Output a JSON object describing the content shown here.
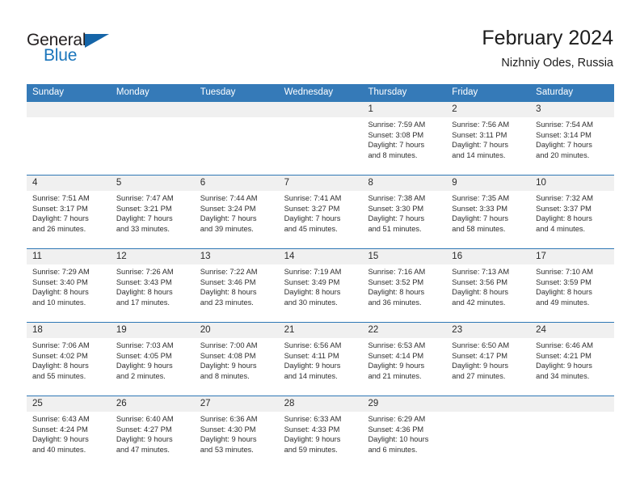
{
  "brand": {
    "name_primary": "General",
    "name_secondary": "Blue",
    "triangle_icon": "triangle-icon",
    "accent_color": "#1a75bb"
  },
  "header": {
    "title": "February 2024",
    "location": "Nizhniy Odes, Russia"
  },
  "colors": {
    "header_blue": "#357ab8",
    "row_separator_blue": "#2f78b5",
    "date_band_gray": "#f0f0f0",
    "logo_blue": "#1a75bb"
  },
  "calendar": {
    "weekday_headers": [
      "Sunday",
      "Monday",
      "Tuesday",
      "Wednesday",
      "Thursday",
      "Friday",
      "Saturday"
    ],
    "weeks": [
      {
        "days": [
          {
            "date": "",
            "sunrise": "",
            "sunset": "",
            "daylight_line1": "",
            "daylight_line2": ""
          },
          {
            "date": "",
            "sunrise": "",
            "sunset": "",
            "daylight_line1": "",
            "daylight_line2": ""
          },
          {
            "date": "",
            "sunrise": "",
            "sunset": "",
            "daylight_line1": "",
            "daylight_line2": ""
          },
          {
            "date": "",
            "sunrise": "",
            "sunset": "",
            "daylight_line1": "",
            "daylight_line2": ""
          },
          {
            "date": "1",
            "sunrise": "Sunrise: 7:59 AM",
            "sunset": "Sunset: 3:08 PM",
            "daylight_line1": "Daylight: 7 hours",
            "daylight_line2": "and 8 minutes."
          },
          {
            "date": "2",
            "sunrise": "Sunrise: 7:56 AM",
            "sunset": "Sunset: 3:11 PM",
            "daylight_line1": "Daylight: 7 hours",
            "daylight_line2": "and 14 minutes."
          },
          {
            "date": "3",
            "sunrise": "Sunrise: 7:54 AM",
            "sunset": "Sunset: 3:14 PM",
            "daylight_line1": "Daylight: 7 hours",
            "daylight_line2": "and 20 minutes."
          }
        ]
      },
      {
        "days": [
          {
            "date": "4",
            "sunrise": "Sunrise: 7:51 AM",
            "sunset": "Sunset: 3:17 PM",
            "daylight_line1": "Daylight: 7 hours",
            "daylight_line2": "and 26 minutes."
          },
          {
            "date": "5",
            "sunrise": "Sunrise: 7:47 AM",
            "sunset": "Sunset: 3:21 PM",
            "daylight_line1": "Daylight: 7 hours",
            "daylight_line2": "and 33 minutes."
          },
          {
            "date": "6",
            "sunrise": "Sunrise: 7:44 AM",
            "sunset": "Sunset: 3:24 PM",
            "daylight_line1": "Daylight: 7 hours",
            "daylight_line2": "and 39 minutes."
          },
          {
            "date": "7",
            "sunrise": "Sunrise: 7:41 AM",
            "sunset": "Sunset: 3:27 PM",
            "daylight_line1": "Daylight: 7 hours",
            "daylight_line2": "and 45 minutes."
          },
          {
            "date": "8",
            "sunrise": "Sunrise: 7:38 AM",
            "sunset": "Sunset: 3:30 PM",
            "daylight_line1": "Daylight: 7 hours",
            "daylight_line2": "and 51 minutes."
          },
          {
            "date": "9",
            "sunrise": "Sunrise: 7:35 AM",
            "sunset": "Sunset: 3:33 PM",
            "daylight_line1": "Daylight: 7 hours",
            "daylight_line2": "and 58 minutes."
          },
          {
            "date": "10",
            "sunrise": "Sunrise: 7:32 AM",
            "sunset": "Sunset: 3:37 PM",
            "daylight_line1": "Daylight: 8 hours",
            "daylight_line2": "and 4 minutes."
          }
        ]
      },
      {
        "days": [
          {
            "date": "11",
            "sunrise": "Sunrise: 7:29 AM",
            "sunset": "Sunset: 3:40 PM",
            "daylight_line1": "Daylight: 8 hours",
            "daylight_line2": "and 10 minutes."
          },
          {
            "date": "12",
            "sunrise": "Sunrise: 7:26 AM",
            "sunset": "Sunset: 3:43 PM",
            "daylight_line1": "Daylight: 8 hours",
            "daylight_line2": "and 17 minutes."
          },
          {
            "date": "13",
            "sunrise": "Sunrise: 7:22 AM",
            "sunset": "Sunset: 3:46 PM",
            "daylight_line1": "Daylight: 8 hours",
            "daylight_line2": "and 23 minutes."
          },
          {
            "date": "14",
            "sunrise": "Sunrise: 7:19 AM",
            "sunset": "Sunset: 3:49 PM",
            "daylight_line1": "Daylight: 8 hours",
            "daylight_line2": "and 30 minutes."
          },
          {
            "date": "15",
            "sunrise": "Sunrise: 7:16 AM",
            "sunset": "Sunset: 3:52 PM",
            "daylight_line1": "Daylight: 8 hours",
            "daylight_line2": "and 36 minutes."
          },
          {
            "date": "16",
            "sunrise": "Sunrise: 7:13 AM",
            "sunset": "Sunset: 3:56 PM",
            "daylight_line1": "Daylight: 8 hours",
            "daylight_line2": "and 42 minutes."
          },
          {
            "date": "17",
            "sunrise": "Sunrise: 7:10 AM",
            "sunset": "Sunset: 3:59 PM",
            "daylight_line1": "Daylight: 8 hours",
            "daylight_line2": "and 49 minutes."
          }
        ]
      },
      {
        "days": [
          {
            "date": "18",
            "sunrise": "Sunrise: 7:06 AM",
            "sunset": "Sunset: 4:02 PM",
            "daylight_line1": "Daylight: 8 hours",
            "daylight_line2": "and 55 minutes."
          },
          {
            "date": "19",
            "sunrise": "Sunrise: 7:03 AM",
            "sunset": "Sunset: 4:05 PM",
            "daylight_line1": "Daylight: 9 hours",
            "daylight_line2": "and 2 minutes."
          },
          {
            "date": "20",
            "sunrise": "Sunrise: 7:00 AM",
            "sunset": "Sunset: 4:08 PM",
            "daylight_line1": "Daylight: 9 hours",
            "daylight_line2": "and 8 minutes."
          },
          {
            "date": "21",
            "sunrise": "Sunrise: 6:56 AM",
            "sunset": "Sunset: 4:11 PM",
            "daylight_line1": "Daylight: 9 hours",
            "daylight_line2": "and 14 minutes."
          },
          {
            "date": "22",
            "sunrise": "Sunrise: 6:53 AM",
            "sunset": "Sunset: 4:14 PM",
            "daylight_line1": "Daylight: 9 hours",
            "daylight_line2": "and 21 minutes."
          },
          {
            "date": "23",
            "sunrise": "Sunrise: 6:50 AM",
            "sunset": "Sunset: 4:17 PM",
            "daylight_line1": "Daylight: 9 hours",
            "daylight_line2": "and 27 minutes."
          },
          {
            "date": "24",
            "sunrise": "Sunrise: 6:46 AM",
            "sunset": "Sunset: 4:21 PM",
            "daylight_line1": "Daylight: 9 hours",
            "daylight_line2": "and 34 minutes."
          }
        ]
      },
      {
        "days": [
          {
            "date": "25",
            "sunrise": "Sunrise: 6:43 AM",
            "sunset": "Sunset: 4:24 PM",
            "daylight_line1": "Daylight: 9 hours",
            "daylight_line2": "and 40 minutes."
          },
          {
            "date": "26",
            "sunrise": "Sunrise: 6:40 AM",
            "sunset": "Sunset: 4:27 PM",
            "daylight_line1": "Daylight: 9 hours",
            "daylight_line2": "and 47 minutes."
          },
          {
            "date": "27",
            "sunrise": "Sunrise: 6:36 AM",
            "sunset": "Sunset: 4:30 PM",
            "daylight_line1": "Daylight: 9 hours",
            "daylight_line2": "and 53 minutes."
          },
          {
            "date": "28",
            "sunrise": "Sunrise: 6:33 AM",
            "sunset": "Sunset: 4:33 PM",
            "daylight_line1": "Daylight: 9 hours",
            "daylight_line2": "and 59 minutes."
          },
          {
            "date": "29",
            "sunrise": "Sunrise: 6:29 AM",
            "sunset": "Sunset: 4:36 PM",
            "daylight_line1": "Daylight: 10 hours",
            "daylight_line2": "and 6 minutes."
          },
          {
            "date": "",
            "sunrise": "",
            "sunset": "",
            "daylight_line1": "",
            "daylight_line2": ""
          },
          {
            "date": "",
            "sunrise": "",
            "sunset": "",
            "daylight_line1": "",
            "daylight_line2": ""
          }
        ]
      }
    ]
  }
}
